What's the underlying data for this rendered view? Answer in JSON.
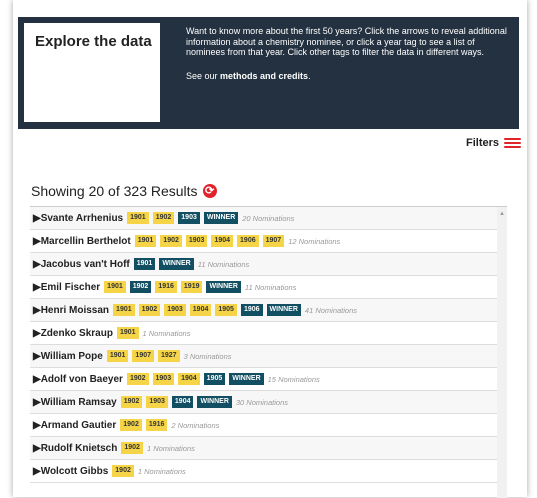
{
  "header": {
    "title": "Explore the data",
    "intro": "Want to know more about the first 50 years? Click the arrows to reveal additional information about a chemistry nominee, or click a year tag to see a list of nominees from that year. Click other tags to filter the data in different ways.",
    "methods_prefix": "See our ",
    "methods_link": "methods and credits",
    "methods_suffix": "."
  },
  "filters": {
    "label": "Filters",
    "icon": "hamburger-menu-icon",
    "color": "#e0222a"
  },
  "results": {
    "showing_text": "Showing 20 of 323 Results",
    "reload_icon": "refresh-icon"
  },
  "colors": {
    "header_bg": "#233140",
    "year_tag": "#f5d547",
    "winner_tag": "#134f63",
    "accent": "#e0222a"
  },
  "rows": [
    {
      "name": "Svante Arrhenius",
      "tags": [
        {
          "t": "1901",
          "k": "y"
        },
        {
          "t": "1902",
          "k": "y"
        },
        {
          "t": "1903",
          "k": "w"
        },
        {
          "t": "WINNER",
          "k": "w"
        }
      ],
      "noms": "20 Nominations"
    },
    {
      "name": "Marcellin Berthelot",
      "tags": [
        {
          "t": "1901",
          "k": "y"
        },
        {
          "t": "1902",
          "k": "y"
        },
        {
          "t": "1903",
          "k": "y"
        },
        {
          "t": "1904",
          "k": "y"
        },
        {
          "t": "1906",
          "k": "y"
        },
        {
          "t": "1907",
          "k": "y"
        }
      ],
      "noms": "12 Nominations"
    },
    {
      "name": "Jacobus van't Hoff",
      "tags": [
        {
          "t": "1901",
          "k": "w"
        },
        {
          "t": "WINNER",
          "k": "w"
        }
      ],
      "noms": "11 Nominations"
    },
    {
      "name": "Emil Fischer",
      "tags": [
        {
          "t": "1901",
          "k": "y"
        },
        {
          "t": "1902",
          "k": "w"
        },
        {
          "t": "1916",
          "k": "y"
        },
        {
          "t": "1919",
          "k": "y"
        },
        {
          "t": "WINNER",
          "k": "w"
        }
      ],
      "noms": "11 Nominations"
    },
    {
      "name": "Henri Moissan",
      "tags": [
        {
          "t": "1901",
          "k": "y"
        },
        {
          "t": "1902",
          "k": "y"
        },
        {
          "t": "1903",
          "k": "y"
        },
        {
          "t": "1904",
          "k": "y"
        },
        {
          "t": "1905",
          "k": "y"
        },
        {
          "t": "1906",
          "k": "w"
        },
        {
          "t": "WINNER",
          "k": "w"
        }
      ],
      "noms": "41 Nominations"
    },
    {
      "name": "Zdenko Skraup",
      "tags": [
        {
          "t": "1901",
          "k": "y"
        }
      ],
      "noms": "1 Nominations"
    },
    {
      "name": "William Pope",
      "tags": [
        {
          "t": "1901",
          "k": "y"
        },
        {
          "t": "1907",
          "k": "y"
        },
        {
          "t": "1927",
          "k": "y"
        }
      ],
      "noms": "3 Nominations"
    },
    {
      "name": "Adolf von Baeyer",
      "tags": [
        {
          "t": "1902",
          "k": "y"
        },
        {
          "t": "1903",
          "k": "y"
        },
        {
          "t": "1904",
          "k": "y"
        },
        {
          "t": "1905",
          "k": "w"
        },
        {
          "t": "WINNER",
          "k": "w"
        }
      ],
      "noms": "15 Nominations"
    },
    {
      "name": "William Ramsay",
      "tags": [
        {
          "t": "1902",
          "k": "y"
        },
        {
          "t": "1903",
          "k": "y"
        },
        {
          "t": "1904",
          "k": "w"
        },
        {
          "t": "WINNER",
          "k": "w"
        }
      ],
      "noms": "30 Nominations"
    },
    {
      "name": "Armand Gautier",
      "tags": [
        {
          "t": "1902",
          "k": "y"
        },
        {
          "t": "1916",
          "k": "y"
        }
      ],
      "noms": "2 Nominations"
    },
    {
      "name": "Rudolf Knietsch",
      "tags": [
        {
          "t": "1902",
          "k": "y"
        }
      ],
      "noms": "1 Nominations"
    },
    {
      "name": "Wolcott Gibbs",
      "tags": [
        {
          "t": "1902",
          "k": "y"
        }
      ],
      "noms": "1 Nominations"
    }
  ]
}
